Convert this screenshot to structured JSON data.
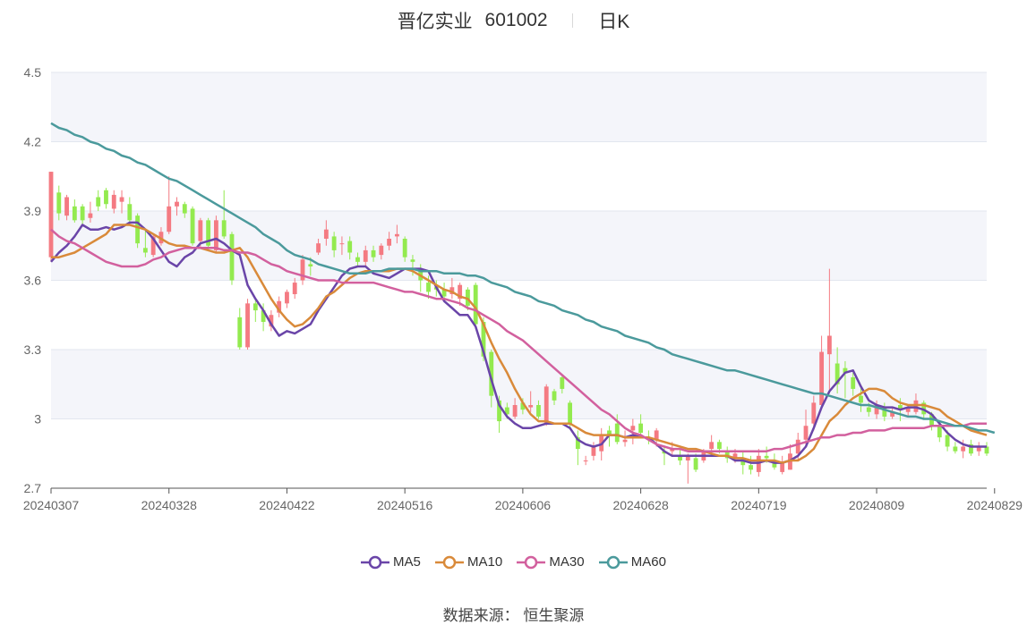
{
  "header": {
    "name": "晋亿实业",
    "code": "601002",
    "period": "日K"
  },
  "source": {
    "label": "数据来源：",
    "value": "恒生聚源"
  },
  "colors": {
    "up": "#f47a82",
    "down": "#93ea4f",
    "MA5": "#6a45a8",
    "MA10": "#d98a3a",
    "MA30": "#d2609e",
    "MA60": "#4b9a9c",
    "band": "#f4f5fa",
    "grid": "#e2e6ef"
  },
  "chart_data": {
    "type": "candlestick",
    "ylim": [
      2.7,
      4.5
    ],
    "yticks": [
      "2.7",
      "3",
      "3.3",
      "3.6",
      "3.9",
      "4.2",
      "4.5"
    ],
    "ytick_values": [
      2.7,
      3.0,
      3.3,
      3.6,
      3.9,
      4.2,
      4.5
    ],
    "xticks": [
      {
        "label": "20240307",
        "index": 0
      },
      {
        "label": "20240328",
        "index": 15
      },
      {
        "label": "20240422",
        "index": 30
      },
      {
        "label": "20240516",
        "index": 45
      },
      {
        "label": "20240606",
        "index": 60
      },
      {
        "label": "20240628",
        "index": 75
      },
      {
        "label": "20240719",
        "index": 90
      },
      {
        "label": "20240809",
        "index": 105
      },
      {
        "label": "20240829",
        "index": 120
      }
    ],
    "candles": [
      [
        3.7,
        4.07,
        4.07,
        3.68
      ],
      [
        3.98,
        3.89,
        4.01,
        3.86
      ],
      [
        3.88,
        3.96,
        3.97,
        3.86
      ],
      [
        3.92,
        3.86,
        3.95,
        3.85
      ],
      [
        3.92,
        3.86,
        3.93,
        3.84
      ],
      [
        3.87,
        3.89,
        3.94,
        3.85
      ],
      [
        3.96,
        3.92,
        3.99,
        3.9
      ],
      [
        3.99,
        3.93,
        4.0,
        3.91
      ],
      [
        3.91,
        3.97,
        3.99,
        3.89
      ],
      [
        3.94,
        3.96,
        3.99,
        3.89
      ],
      [
        3.93,
        3.86,
        3.96,
        3.84
      ],
      [
        3.88,
        3.76,
        3.89,
        3.74
      ],
      [
        3.74,
        3.72,
        3.82,
        3.7
      ],
      [
        3.71,
        3.79,
        3.8,
        3.7
      ],
      [
        3.76,
        3.81,
        3.83,
        3.75
      ],
      [
        3.81,
        3.92,
        4.05,
        3.8
      ],
      [
        3.92,
        3.94,
        3.96,
        3.88
      ],
      [
        3.93,
        3.89,
        3.94,
        3.87
      ],
      [
        3.91,
        3.76,
        3.92,
        3.75
      ],
      [
        3.77,
        3.86,
        3.87,
        3.74
      ],
      [
        3.86,
        3.75,
        3.87,
        3.73
      ],
      [
        3.73,
        3.86,
        3.88,
        3.72
      ],
      [
        3.86,
        3.79,
        3.99,
        3.78
      ],
      [
        3.8,
        3.6,
        3.81,
        3.58
      ],
      [
        3.44,
        3.31,
        3.48,
        3.3
      ],
      [
        3.31,
        3.5,
        3.52,
        3.3
      ],
      [
        3.5,
        3.47,
        3.52,
        3.42
      ],
      [
        3.47,
        3.42,
        3.5,
        3.38
      ],
      [
        3.4,
        3.45,
        3.47,
        3.38
      ],
      [
        3.46,
        3.51,
        3.53,
        3.44
      ],
      [
        3.5,
        3.55,
        3.56,
        3.48
      ],
      [
        3.54,
        3.59,
        3.61,
        3.52
      ],
      [
        3.6,
        3.69,
        3.71,
        3.58
      ],
      [
        3.67,
        3.66,
        3.7,
        3.62
      ],
      [
        3.72,
        3.76,
        3.78,
        3.71
      ],
      [
        3.78,
        3.82,
        3.86,
        3.75
      ],
      [
        3.79,
        3.73,
        3.81,
        3.7
      ],
      [
        3.76,
        3.76,
        3.79,
        3.71
      ],
      [
        3.77,
        3.72,
        3.79,
        3.69
      ],
      [
        3.7,
        3.68,
        3.72,
        3.66
      ],
      [
        3.68,
        3.73,
        3.75,
        3.66
      ],
      [
        3.73,
        3.7,
        3.75,
        3.68
      ],
      [
        3.71,
        3.75,
        3.76,
        3.69
      ],
      [
        3.75,
        3.78,
        3.81,
        3.73
      ],
      [
        3.79,
        3.8,
        3.84,
        3.76
      ],
      [
        3.78,
        3.7,
        3.79,
        3.68
      ],
      [
        3.69,
        3.68,
        3.71,
        3.62
      ],
      [
        3.65,
        3.6,
        3.67,
        3.55
      ],
      [
        3.59,
        3.55,
        3.62,
        3.52
      ],
      [
        3.57,
        3.56,
        3.6,
        3.53
      ],
      [
        3.56,
        3.53,
        3.59,
        3.51
      ],
      [
        3.54,
        3.57,
        3.61,
        3.52
      ],
      [
        3.52,
        3.58,
        3.59,
        3.49
      ],
      [
        3.56,
        3.49,
        3.57,
        3.47
      ],
      [
        3.58,
        3.41,
        3.59,
        3.39
      ],
      [
        3.42,
        3.27,
        3.44,
        3.25
      ],
      [
        3.29,
        3.1,
        3.3,
        3.05
      ],
      [
        3.08,
        2.99,
        3.1,
        2.94
      ],
      [
        3.05,
        3.02,
        3.07,
        3.0
      ],
      [
        3.01,
        3.06,
        3.09,
        3.0
      ],
      [
        3.07,
        3.04,
        3.09,
        3.02
      ],
      [
        3.05,
        3.06,
        3.12,
        3.03
      ],
      [
        3.06,
        3.01,
        3.08,
        3.0
      ],
      [
        2.98,
        3.14,
        3.15,
        2.97
      ],
      [
        3.12,
        3.08,
        3.13,
        3.06
      ],
      [
        3.18,
        3.13,
        3.19,
        3.11
      ],
      [
        3.07,
        2.98,
        3.08,
        2.96
      ],
      [
        2.92,
        2.87,
        2.95,
        2.8
      ],
      [
        2.82,
        2.82,
        2.84,
        2.8
      ],
      [
        2.84,
        2.88,
        2.9,
        2.82
      ],
      [
        2.86,
        2.93,
        2.96,
        2.82
      ],
      [
        2.95,
        2.93,
        2.97,
        2.88
      ],
      [
        2.98,
        2.9,
        3.02,
        2.89
      ],
      [
        2.9,
        2.91,
        2.95,
        2.88
      ],
      [
        2.95,
        2.97,
        3.0,
        2.89
      ],
      [
        2.98,
        2.94,
        3.02,
        2.92
      ],
      [
        2.92,
        2.91,
        2.95,
        2.89
      ],
      [
        2.91,
        2.95,
        2.96,
        2.88
      ],
      [
        2.86,
        2.85,
        2.88,
        2.8
      ],
      [
        2.86,
        2.87,
        2.9,
        2.84
      ],
      [
        2.84,
        2.82,
        2.87,
        2.8
      ],
      [
        2.82,
        2.84,
        2.85,
        2.72
      ],
      [
        2.83,
        2.78,
        2.85,
        2.77
      ],
      [
        2.82,
        2.86,
        2.87,
        2.81
      ],
      [
        2.87,
        2.9,
        2.93,
        2.84
      ],
      [
        2.9,
        2.87,
        2.91,
        2.85
      ],
      [
        2.86,
        2.83,
        2.88,
        2.81
      ],
      [
        2.83,
        2.85,
        2.87,
        2.81
      ],
      [
        2.83,
        2.8,
        2.86,
        2.76
      ],
      [
        2.8,
        2.78,
        2.84,
        2.76
      ],
      [
        2.77,
        2.84,
        2.87,
        2.75
      ],
      [
        2.84,
        2.83,
        2.88,
        2.81
      ],
      [
        2.82,
        2.79,
        2.85,
        2.78
      ],
      [
        2.77,
        2.81,
        2.84,
        2.76
      ],
      [
        2.78,
        2.85,
        2.89,
        2.78
      ],
      [
        2.85,
        2.91,
        2.94,
        2.82
      ],
      [
        2.91,
        2.97,
        3.04,
        2.88
      ],
      [
        2.98,
        3.07,
        3.1,
        2.95
      ],
      [
        3.06,
        3.29,
        3.36,
        3.05
      ],
      [
        3.28,
        3.36,
        3.65,
        3.11
      ],
      [
        3.24,
        3.15,
        3.31,
        3.11
      ],
      [
        3.22,
        3.2,
        3.25,
        3.09
      ],
      [
        3.18,
        3.13,
        3.2,
        3.1
      ],
      [
        3.1,
        3.07,
        3.14,
        3.03
      ],
      [
        3.05,
        3.03,
        3.07,
        3.01
      ],
      [
        3.02,
        3.06,
        3.08,
        3.0
      ],
      [
        3.05,
        3.01,
        3.07,
        2.99
      ],
      [
        3.01,
        3.03,
        3.05,
        3.0
      ],
      [
        3.06,
        3.04,
        3.09,
        2.99
      ],
      [
        3.03,
        3.05,
        3.06,
        3.01
      ],
      [
        3.03,
        3.08,
        3.11,
        3.02
      ],
      [
        3.07,
        3.02,
        3.08,
        3.0
      ],
      [
        3.02,
        2.97,
        3.03,
        2.95
      ],
      [
        2.97,
        2.92,
        2.99,
        2.9
      ],
      [
        2.93,
        2.88,
        2.95,
        2.86
      ],
      [
        2.88,
        2.86,
        2.9,
        2.85
      ],
      [
        2.86,
        2.88,
        2.91,
        2.83
      ],
      [
        2.89,
        2.85,
        2.91,
        2.84
      ],
      [
        2.86,
        2.88,
        2.9,
        2.84
      ],
      [
        2.88,
        2.85,
        2.9,
        2.84
      ]
    ],
    "series": [
      {
        "name": "MA5",
        "values": [
          3.68,
          3.72,
          3.75,
          3.79,
          3.84,
          3.82,
          3.82,
          3.83,
          3.82,
          3.83,
          3.85,
          3.85,
          3.82,
          3.78,
          3.73,
          3.68,
          3.66,
          3.7,
          3.72,
          3.76,
          3.77,
          3.78,
          3.76,
          3.73,
          3.71,
          3.58,
          3.52,
          3.47,
          3.41,
          3.36,
          3.38,
          3.37,
          3.39,
          3.41,
          3.47,
          3.52,
          3.57,
          3.62,
          3.65,
          3.66,
          3.66,
          3.63,
          3.62,
          3.61,
          3.63,
          3.65,
          3.65,
          3.65,
          3.64,
          3.57,
          3.51,
          3.48,
          3.45,
          3.45,
          3.4,
          3.29,
          3.17,
          3.06,
          3.01,
          2.98,
          2.96,
          2.96,
          2.97,
          2.98,
          2.98,
          2.98,
          2.96,
          2.91,
          2.89,
          2.88,
          2.89,
          2.93,
          2.93,
          2.92,
          2.93,
          2.92,
          2.92,
          2.89,
          2.86,
          2.84,
          2.84,
          2.84,
          2.84,
          2.84,
          2.84,
          2.84,
          2.84,
          2.82,
          2.82,
          2.81,
          2.81,
          2.82,
          2.81,
          2.81,
          2.82,
          2.84,
          2.88,
          2.96,
          3.05,
          3.12,
          3.16,
          3.2,
          3.21,
          3.14,
          3.08,
          3.06,
          3.05,
          3.05,
          3.04,
          3.05,
          3.05,
          3.04,
          3.02,
          2.98,
          2.94,
          2.91,
          2.89,
          2.88,
          2.88,
          2.88
        ]
      },
      {
        "name": "MA10",
        "values": [
          3.7,
          3.7,
          3.71,
          3.72,
          3.74,
          3.76,
          3.78,
          3.8,
          3.84,
          3.84,
          3.84,
          3.83,
          3.82,
          3.8,
          3.78,
          3.76,
          3.75,
          3.75,
          3.74,
          3.74,
          3.73,
          3.72,
          3.72,
          3.73,
          3.74,
          3.7,
          3.64,
          3.58,
          3.52,
          3.47,
          3.43,
          3.4,
          3.41,
          3.44,
          3.48,
          3.53,
          3.55,
          3.58,
          3.61,
          3.63,
          3.64,
          3.64,
          3.64,
          3.64,
          3.65,
          3.65,
          3.64,
          3.62,
          3.6,
          3.58,
          3.56,
          3.55,
          3.53,
          3.52,
          3.48,
          3.41,
          3.33,
          3.26,
          3.2,
          3.13,
          3.07,
          3.02,
          2.99,
          2.99,
          2.98,
          2.98,
          2.98,
          2.96,
          2.94,
          2.93,
          2.93,
          2.93,
          2.93,
          2.92,
          2.92,
          2.92,
          2.92,
          2.91,
          2.9,
          2.89,
          2.88,
          2.87,
          2.87,
          2.86,
          2.85,
          2.84,
          2.84,
          2.83,
          2.83,
          2.82,
          2.82,
          2.82,
          2.82,
          2.81,
          2.82,
          2.82,
          2.84,
          2.87,
          2.93,
          2.99,
          3.02,
          3.06,
          3.09,
          3.11,
          3.13,
          3.13,
          3.12,
          3.09,
          3.07,
          3.06,
          3.06,
          3.06,
          3.05,
          3.04,
          3.01,
          2.99,
          2.97,
          2.95,
          2.94,
          2.93
        ]
      },
      {
        "name": "MA30",
        "values": [
          3.82,
          3.79,
          3.77,
          3.76,
          3.74,
          3.72,
          3.7,
          3.68,
          3.67,
          3.66,
          3.66,
          3.66,
          3.67,
          3.69,
          3.7,
          3.72,
          3.73,
          3.74,
          3.74,
          3.74,
          3.74,
          3.74,
          3.73,
          3.73,
          3.72,
          3.72,
          3.71,
          3.69,
          3.67,
          3.66,
          3.64,
          3.63,
          3.62,
          3.61,
          3.6,
          3.6,
          3.6,
          3.59,
          3.59,
          3.59,
          3.59,
          3.59,
          3.58,
          3.57,
          3.56,
          3.55,
          3.55,
          3.54,
          3.53,
          3.52,
          3.52,
          3.51,
          3.5,
          3.48,
          3.47,
          3.45,
          3.43,
          3.41,
          3.38,
          3.36,
          3.34,
          3.31,
          3.28,
          3.25,
          3.22,
          3.19,
          3.16,
          3.13,
          3.1,
          3.07,
          3.04,
          3.02,
          2.99,
          2.96,
          2.94,
          2.93,
          2.91,
          2.89,
          2.88,
          2.87,
          2.87,
          2.86,
          2.86,
          2.86,
          2.86,
          2.86,
          2.86,
          2.86,
          2.86,
          2.86,
          2.86,
          2.86,
          2.87,
          2.87,
          2.88,
          2.89,
          2.9,
          2.91,
          2.92,
          2.92,
          2.93,
          2.93,
          2.94,
          2.94,
          2.95,
          2.95,
          2.95,
          2.96,
          2.96,
          2.96,
          2.96,
          2.96,
          2.97,
          2.97,
          2.97,
          2.97,
          2.97,
          2.98,
          2.98,
          2.98
        ]
      },
      {
        "name": "MA60",
        "values": [
          4.28,
          4.26,
          4.25,
          4.23,
          4.22,
          4.2,
          4.19,
          4.17,
          4.16,
          4.14,
          4.13,
          4.11,
          4.1,
          4.08,
          4.06,
          4.04,
          4.03,
          4.01,
          3.99,
          3.97,
          3.95,
          3.93,
          3.91,
          3.89,
          3.87,
          3.85,
          3.83,
          3.8,
          3.78,
          3.76,
          3.73,
          3.71,
          3.7,
          3.69,
          3.67,
          3.66,
          3.65,
          3.64,
          3.63,
          3.63,
          3.63,
          3.64,
          3.64,
          3.65,
          3.65,
          3.65,
          3.65,
          3.64,
          3.64,
          3.64,
          3.63,
          3.63,
          3.63,
          3.62,
          3.62,
          3.61,
          3.59,
          3.58,
          3.57,
          3.55,
          3.54,
          3.53,
          3.51,
          3.5,
          3.49,
          3.47,
          3.46,
          3.45,
          3.43,
          3.42,
          3.4,
          3.39,
          3.38,
          3.36,
          3.35,
          3.34,
          3.33,
          3.31,
          3.3,
          3.28,
          3.27,
          3.26,
          3.25,
          3.24,
          3.23,
          3.22,
          3.21,
          3.21,
          3.2,
          3.19,
          3.18,
          3.17,
          3.16,
          3.15,
          3.14,
          3.13,
          3.12,
          3.11,
          3.11,
          3.1,
          3.09,
          3.08,
          3.07,
          3.06,
          3.06,
          3.05,
          3.04,
          3.03,
          3.02,
          3.01,
          3.01,
          3.0,
          3.0,
          2.99,
          2.98,
          2.97,
          2.97,
          2.96,
          2.95,
          2.95,
          2.94
        ]
      }
    ]
  }
}
